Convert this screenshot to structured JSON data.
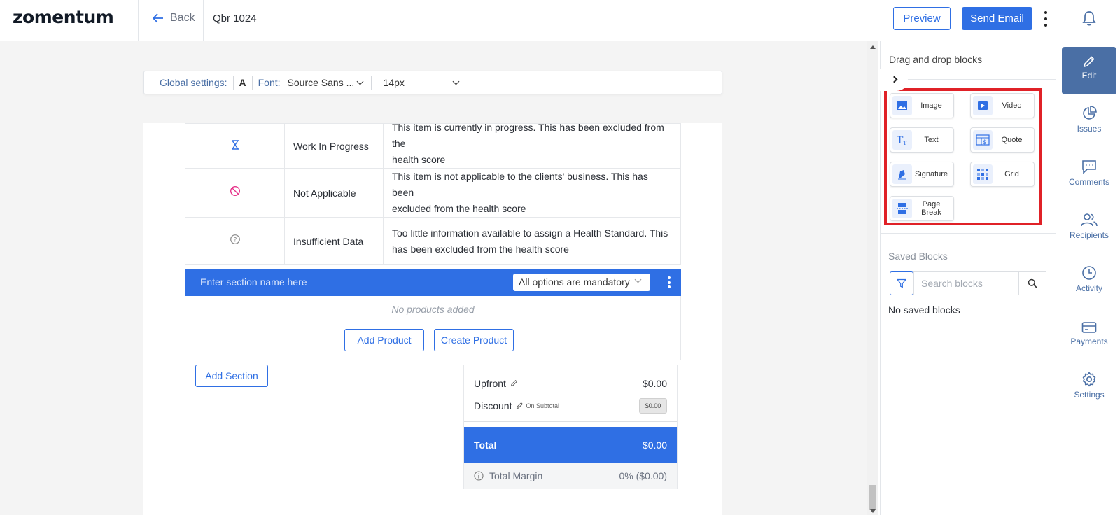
{
  "header": {
    "logo": "zomentum",
    "back_label": "Back",
    "doc_title": "Qbr 1024",
    "preview_label": "Preview",
    "send_email_label": "Send Email"
  },
  "global_settings": {
    "label": "Global settings:",
    "font_label": "Font:",
    "font_value": "Source Sans ...",
    "size_value": "14px"
  },
  "legend": [
    {
      "icon": "hourglass-icon",
      "label": "Work In Progress",
      "desc_line1": "This item is currently in progress. This has been excluded from the",
      "desc_line2": "health score"
    },
    {
      "icon": "not-applicable-icon",
      "label": "Not Applicable",
      "desc_line1": "This item is not applicable to the clients' business. This has been",
      "desc_line2": "excluded from the health score"
    },
    {
      "icon": "question-icon",
      "label": "Insufficient Data",
      "desc_line1": "Too little information available to assign a Health Standard. This",
      "desc_line2": "has been excluded from the health score"
    }
  ],
  "section": {
    "name_placeholder": "Enter section name here",
    "mandatory_option": "All options are mandatory",
    "empty_text": "No products added",
    "add_product_label": "Add Product",
    "create_product_label": "Create Product"
  },
  "add_section_label": "Add Section",
  "summary": {
    "upfront_label": "Upfront",
    "upfront_value": "$0.00",
    "discount_label": "Discount",
    "discount_note": "On Subtotal",
    "discount_value": "$0.00",
    "total_label": "Total",
    "total_value": "$0.00",
    "margin_label": "Total Margin",
    "margin_value": "0% ($0.00)"
  },
  "right_panel": {
    "title": "Drag and drop blocks",
    "blocks": [
      {
        "label": "Image",
        "icon": "image-icon"
      },
      {
        "label": "Video",
        "icon": "video-icon"
      },
      {
        "label": "Text",
        "icon": "text-icon"
      },
      {
        "label": "Quote",
        "icon": "quote-icon"
      },
      {
        "label": "Signature",
        "icon": "signature-icon"
      },
      {
        "label": "Grid",
        "icon": "grid-icon"
      },
      {
        "label": "Page Break",
        "icon": "page-break-icon"
      }
    ],
    "saved_title": "Saved Blocks",
    "search_placeholder": "Search blocks",
    "no_saved": "No saved blocks"
  },
  "rail": [
    {
      "label": "Edit",
      "icon": "pencil-icon",
      "active": true
    },
    {
      "label": "Issues",
      "icon": "pie-chart-icon"
    },
    {
      "label": "Comments",
      "icon": "comment-icon"
    },
    {
      "label": "Recipients",
      "icon": "users-icon"
    },
    {
      "label": "Activity",
      "icon": "clock-icon"
    },
    {
      "label": "Payments",
      "icon": "card-icon"
    },
    {
      "label": "Settings",
      "icon": "gear-icon"
    }
  ],
  "colors": {
    "accent": "#2f6fe4",
    "rail_active": "#4a6fa5",
    "highlight_border": "#e02127"
  }
}
